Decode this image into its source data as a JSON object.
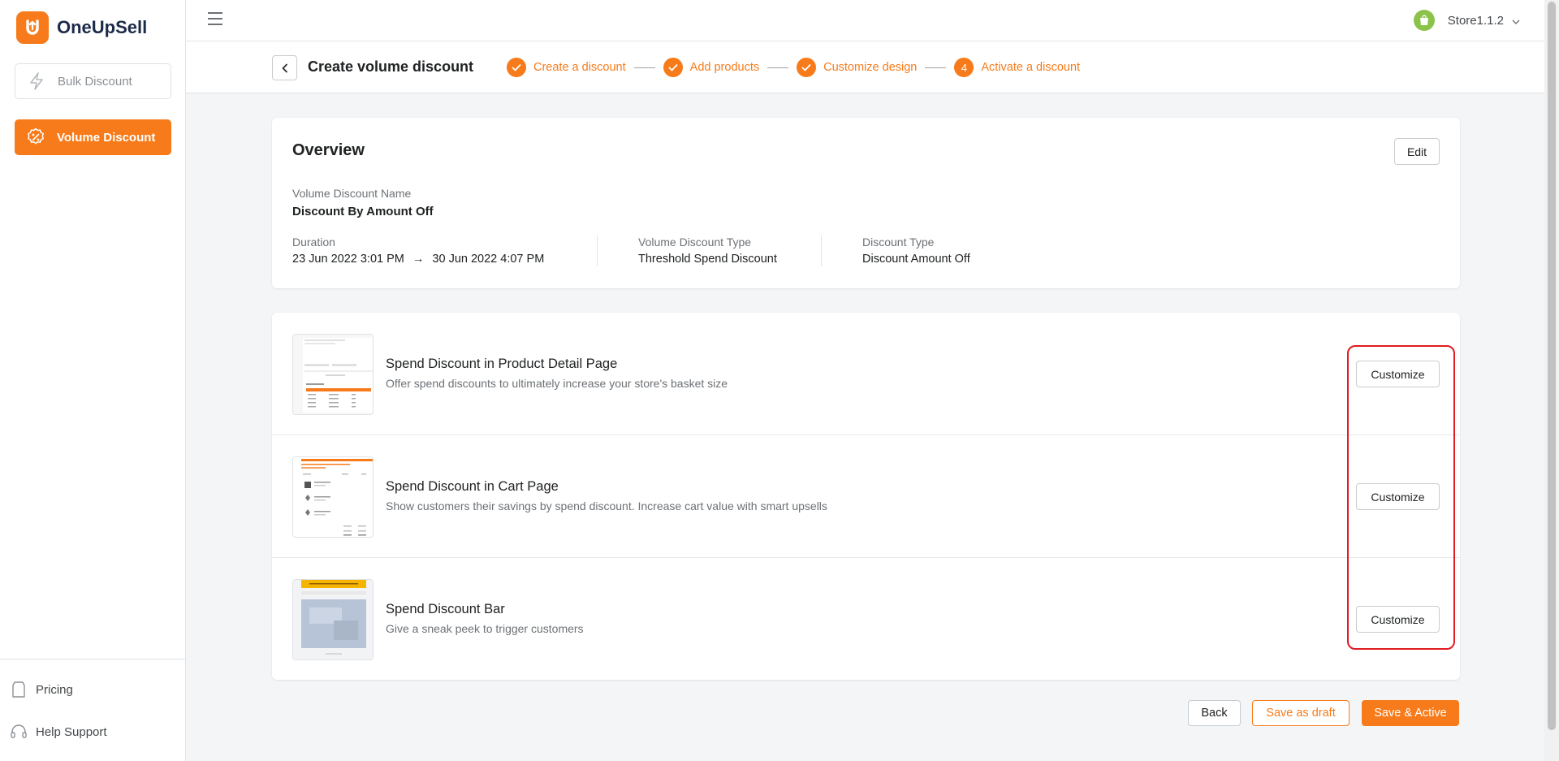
{
  "app": {
    "name": "OneUpSell"
  },
  "sidebar": {
    "items": [
      {
        "label": "Bulk Discount"
      },
      {
        "label": "Volume Discount"
      }
    ],
    "bottom": [
      {
        "label": "Pricing"
      },
      {
        "label": "Help Support"
      }
    ]
  },
  "topbar": {
    "store_name": "Store1.1.2"
  },
  "header": {
    "title": "Create volume discount",
    "steps": [
      {
        "label": "Create a discount",
        "status": "done"
      },
      {
        "label": "Add products",
        "status": "done"
      },
      {
        "label": "Customize design",
        "status": "done"
      },
      {
        "label": "Activate a discount",
        "status": "current",
        "number": "4"
      }
    ]
  },
  "overview": {
    "title": "Overview",
    "edit_label": "Edit",
    "name_label": "Volume Discount Name",
    "name_value": "Discount By Amount Off",
    "duration_label": "Duration",
    "duration_start": "23 Jun 2022 3:01 PM",
    "duration_arrow": "→",
    "duration_end": "30 Jun 2022 4:07 PM",
    "vd_type_label": "Volume Discount Type",
    "vd_type_value": "Threshold Spend Discount",
    "discount_type_label": "Discount Type",
    "discount_type_value": "Discount Amount Off"
  },
  "designs": [
    {
      "title": "Spend Discount in Product Detail Page",
      "desc": "Offer spend discounts to ultimately increase your store's basket size",
      "button": "Customize"
    },
    {
      "title": "Spend Discount in Cart Page",
      "desc": "Show customers their savings by spend discount. Increase cart value with smart upsells",
      "button": "Customize"
    },
    {
      "title": "Spend Discount Bar",
      "desc": "Give a sneak peek to trigger customers",
      "button": "Customize"
    }
  ],
  "footer": {
    "back": "Back",
    "draft": "Save as draft",
    "save": "Save & Active"
  },
  "colors": {
    "accent": "#f77b1a",
    "highlight": "#e11b22",
    "store_avatar": "#8bc34a"
  }
}
